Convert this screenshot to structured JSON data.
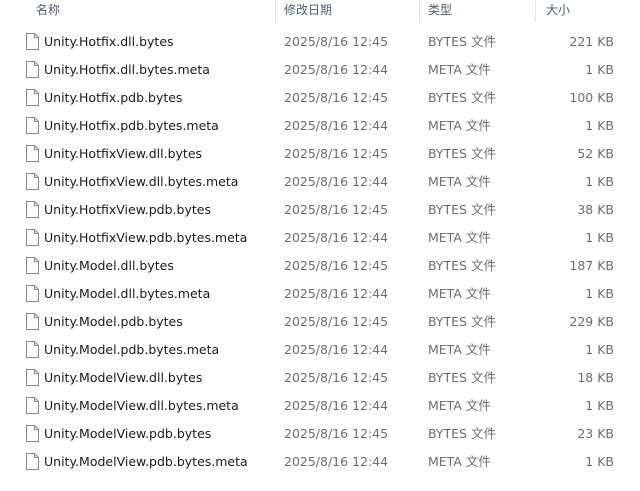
{
  "columns": {
    "name": "名称",
    "date": "修改日期",
    "type": "类型",
    "size": "大小"
  },
  "files": [
    {
      "name": "Unity.Hotfix.dll.bytes",
      "date": "2025/8/16 12:45",
      "type": "BYTES 文件",
      "size": "221 KB"
    },
    {
      "name": "Unity.Hotfix.dll.bytes.meta",
      "date": "2025/8/16 12:44",
      "type": "META 文件",
      "size": "1 KB"
    },
    {
      "name": "Unity.Hotfix.pdb.bytes",
      "date": "2025/8/16 12:45",
      "type": "BYTES 文件",
      "size": "100 KB"
    },
    {
      "name": "Unity.Hotfix.pdb.bytes.meta",
      "date": "2025/8/16 12:44",
      "type": "META 文件",
      "size": "1 KB"
    },
    {
      "name": "Unity.HotfixView.dll.bytes",
      "date": "2025/8/16 12:45",
      "type": "BYTES 文件",
      "size": "52 KB"
    },
    {
      "name": "Unity.HotfixView.dll.bytes.meta",
      "date": "2025/8/16 12:44",
      "type": "META 文件",
      "size": "1 KB"
    },
    {
      "name": "Unity.HotfixView.pdb.bytes",
      "date": "2025/8/16 12:45",
      "type": "BYTES 文件",
      "size": "38 KB"
    },
    {
      "name": "Unity.HotfixView.pdb.bytes.meta",
      "date": "2025/8/16 12:44",
      "type": "META 文件",
      "size": "1 KB"
    },
    {
      "name": "Unity.Model.dll.bytes",
      "date": "2025/8/16 12:45",
      "type": "BYTES 文件",
      "size": "187 KB"
    },
    {
      "name": "Unity.Model.dll.bytes.meta",
      "date": "2025/8/16 12:44",
      "type": "META 文件",
      "size": "1 KB"
    },
    {
      "name": "Unity.Model.pdb.bytes",
      "date": "2025/8/16 12:45",
      "type": "BYTES 文件",
      "size": "229 KB"
    },
    {
      "name": "Unity.Model.pdb.bytes.meta",
      "date": "2025/8/16 12:44",
      "type": "META 文件",
      "size": "1 KB"
    },
    {
      "name": "Unity.ModelView.dll.bytes",
      "date": "2025/8/16 12:45",
      "type": "BYTES 文件",
      "size": "18 KB"
    },
    {
      "name": "Unity.ModelView.dll.bytes.meta",
      "date": "2025/8/16 12:44",
      "type": "META 文件",
      "size": "1 KB"
    },
    {
      "name": "Unity.ModelView.pdb.bytes",
      "date": "2025/8/16 12:45",
      "type": "BYTES 文件",
      "size": "23 KB"
    },
    {
      "name": "Unity.ModelView.pdb.bytes.meta",
      "date": "2025/8/16 12:44",
      "type": "META 文件",
      "size": "1 KB"
    }
  ],
  "icons": {
    "file": "file-icon"
  },
  "colors": {
    "header_text": "#4c607a",
    "name_text": "#1a1a1a",
    "meta_text": "#6d6d6d",
    "background": "#ffffff"
  }
}
